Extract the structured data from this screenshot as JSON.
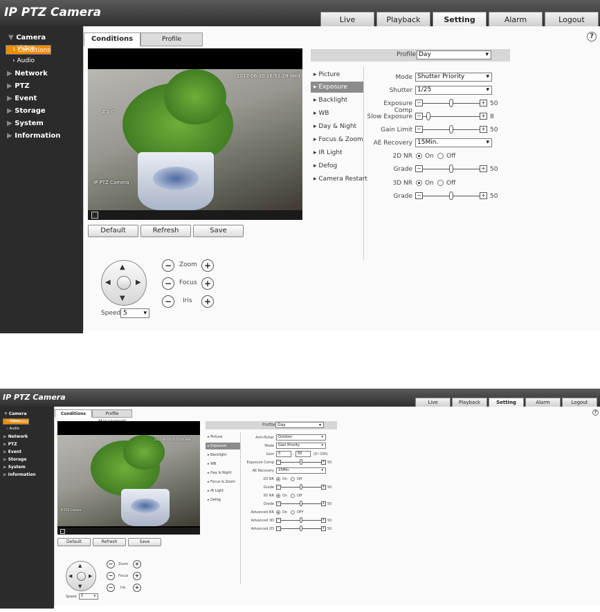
{
  "screens": [
    {
      "app_title": "IP PTZ Camera",
      "top_tabs": [
        "Live",
        "Playback",
        "Setting",
        "Alarm",
        "Logout"
      ],
      "active_top_tab": "Setting",
      "sidebar": {
        "camera": "Camera",
        "conditions": "Conditions",
        "video": "Video",
        "audio": "Audio",
        "network": "Network",
        "ptz": "PTZ",
        "event": "Event",
        "storage": "Storage",
        "system": "System",
        "information": "Information"
      },
      "sub_tabs": [
        "Conditions",
        "Profile Management"
      ],
      "help_icon": "?",
      "video": {
        "timestamp": "2017-06-20 16:52:29 Wed",
        "zoom_osd": "Z 1.0",
        "channel_name": "IP PTZ Camera"
      },
      "buttons": {
        "default": "Default",
        "refresh": "Refresh",
        "save": "Save"
      },
      "ptz": {
        "zoom": "Zoom",
        "focus": "Focus",
        "iris": "Iris",
        "speed_label": "Speed",
        "speed_value": "5",
        "minus": "−",
        "plus": "+"
      },
      "profile": {
        "label": "Profile",
        "value": "Day"
      },
      "menu": [
        "Picture",
        "Exposure",
        "Backlight",
        "WB",
        "Day & Night",
        "Focus & Zoom",
        "IR Light",
        "Defog",
        "Camera Restart"
      ],
      "active_menu": "Exposure",
      "settings": {
        "mode_label": "Mode",
        "mode_value": "Shutter Priority",
        "shutter_label": "Shutter",
        "shutter_value": "1/25",
        "exposure_comp_label": "Exposure Comp",
        "exposure_comp_value": "50",
        "exposure_comp_level": 0.5,
        "slow_exposure_label": "Slow Exposure",
        "slow_exposure_value": "8",
        "slow_exposure_level": 0.1,
        "gain_limit_label": "Gain Limit",
        "gain_limit_value": "50",
        "gain_limit_level": 0.5,
        "ae_recovery_label": "AE Recovery",
        "ae_recovery_value": "15Min.",
        "nr2d_label": "2D NR",
        "on": "On",
        "off": "Off",
        "grade1_label": "Grade",
        "grade1_value": "50",
        "grade1_level": 0.5,
        "nr3d_label": "3D NR",
        "grade2_label": "Grade",
        "grade2_value": "50",
        "grade2_level": 0.5
      }
    },
    {
      "app_title": "IP PTZ Camera",
      "top_tabs": [
        "Live",
        "Playback",
        "Setting",
        "Alarm",
        "Logout"
      ],
      "active_top_tab": "Setting",
      "sidebar": {
        "camera": "Camera",
        "conditions": "Conditions",
        "video": "Video",
        "audio": "Audio",
        "network": "Network",
        "ptz": "PTZ",
        "event": "Event",
        "storage": "Storage",
        "system": "System",
        "information": "Information"
      },
      "sub_tabs": [
        "Conditions",
        "Profile Management"
      ],
      "help_icon": "?",
      "video": {
        "timestamp": "2017-06-20 16:52:29 Wed",
        "channel_name": "IP PTZ Camera"
      },
      "buttons": {
        "default": "Default",
        "refresh": "Refresh",
        "save": "Save"
      },
      "ptz": {
        "zoom": "Zoom",
        "focus": "Focus",
        "iris": "Iris",
        "speed_label": "Speed",
        "speed_value": "5",
        "minus": "−",
        "plus": "+"
      },
      "profile": {
        "label": "Profile",
        "value": "Day"
      },
      "menu": [
        "Picture",
        "Exposure",
        "Backlight",
        "WB",
        "Day & Night",
        "Focus & Zoom",
        "IR Light",
        "Defog"
      ],
      "active_menu": "Exposure",
      "settings": {
        "anti_flicker_label": "Anti-flicker",
        "anti_flicker_value": "Outdoor",
        "mode_label": "Mode",
        "mode_value": "Gain Priority",
        "gain_label": "Gain",
        "gain_min": "0",
        "gain_sep": "-",
        "gain_max": "50",
        "gain_range": "(0~100)",
        "exposure_comp_label": "Exposure Comp",
        "exposure_comp_value": "50",
        "exposure_comp_level": 0.5,
        "ae_recovery_label": "AE Recovery",
        "ae_recovery_value": "15Min.",
        "nr2d_label": "2D NR",
        "on": "On",
        "off": "Off",
        "off_caps": "OFF",
        "grade1_label": "Grade",
        "grade1_value": "50",
        "grade1_level": 0.5,
        "nr3d_label": "3D NR",
        "grade2_label": "Grade",
        "grade2_value": "50",
        "grade2_level": 0.5,
        "advanced_nr_label": "Advanced NR",
        "advanced3d_label": "Advanced 3D",
        "advanced3d_value": "50",
        "advanced3d_level": 0.5,
        "advanced2d_label": "Advanced 2D",
        "advanced2d_value": "50",
        "advanced2d_level": 0.5
      }
    }
  ]
}
